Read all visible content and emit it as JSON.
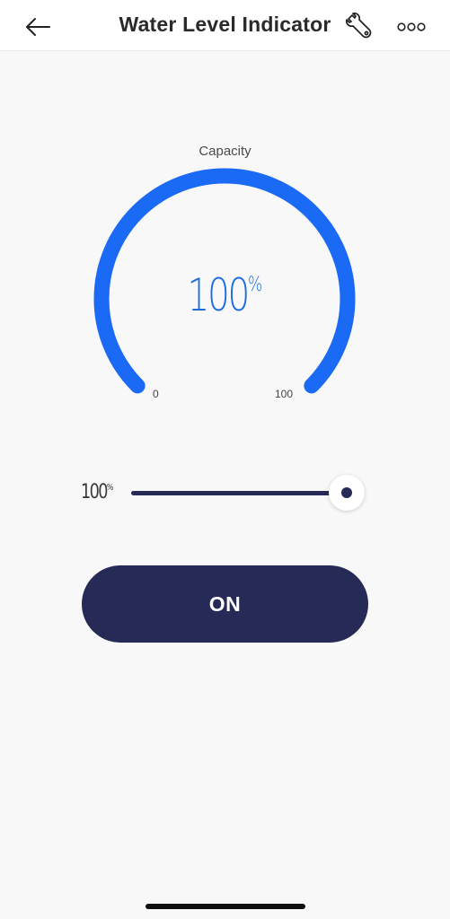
{
  "header": {
    "title": "Water Level Indicator",
    "back_icon": "arrow-left-icon",
    "settings_icon": "wrench-icon",
    "more_icon": "more-dots-icon"
  },
  "gauge": {
    "label": "Capacity",
    "value": "100",
    "unit": "%",
    "min_label": "0",
    "max_label": "100",
    "level": 100,
    "color": "#1a6af5"
  },
  "slider": {
    "value": "100",
    "unit": "%",
    "level": 100,
    "color": "#262a57"
  },
  "power_button": {
    "label": "ON",
    "color": "#262a57"
  }
}
